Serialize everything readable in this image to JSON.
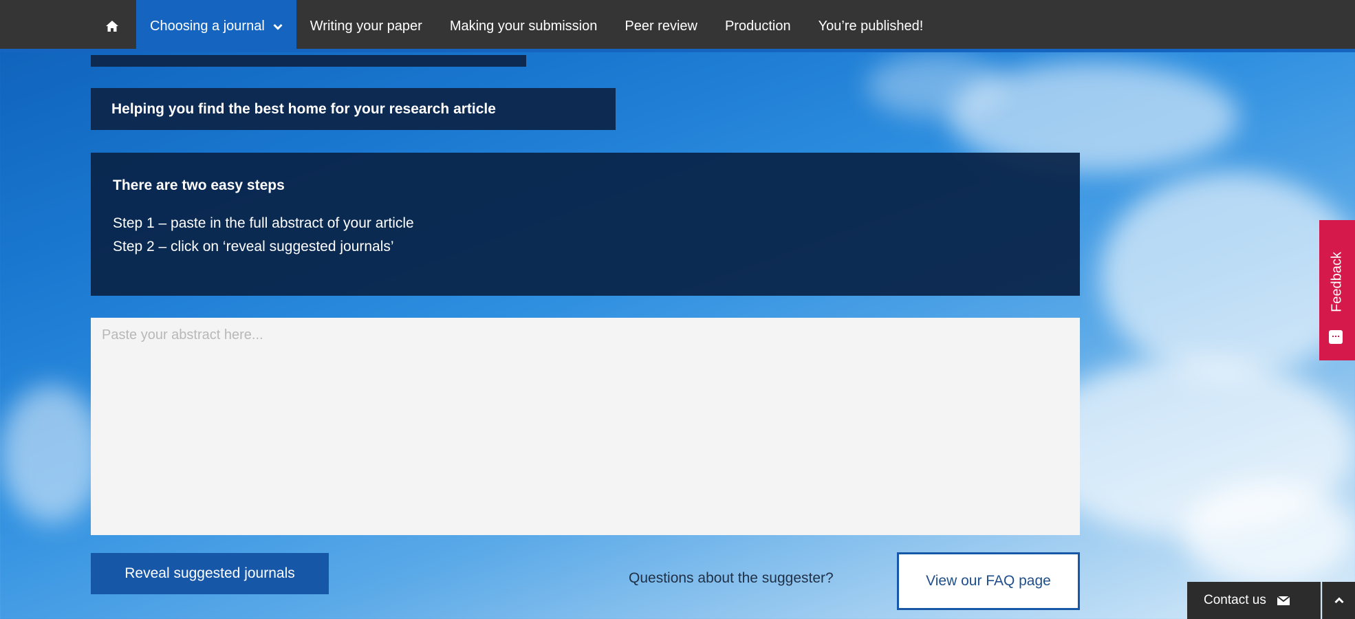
{
  "nav": {
    "home_icon": "home-icon",
    "items": [
      {
        "label": "Choosing a journal",
        "active": true
      },
      {
        "label": "Writing your paper"
      },
      {
        "label": "Making your submission"
      },
      {
        "label": "Peer review"
      },
      {
        "label": "Production"
      },
      {
        "label": "You’re published!"
      }
    ],
    "chevron_icon": "chevron-down-icon"
  },
  "hero": {
    "heading": "Helping you find the best home for your research article",
    "steps_title": "There are two easy steps",
    "step1": "Step 1 – paste in the full abstract of your article",
    "step2": "Step 2 – click on ‘reveal suggested journals’"
  },
  "abstract": {
    "placeholder": "Paste your abstract here...",
    "value": ""
  },
  "actions": {
    "reveal_label": "Reveal suggested journals",
    "questions_text": "Questions about the suggester?",
    "faq_label": "View our FAQ page"
  },
  "feedback": {
    "label": "Feedback",
    "icon": "chat-icon"
  },
  "footer": {
    "contact_label": "Contact us",
    "contact_icon": "envelope-icon",
    "top_icon": "chevron-up-icon"
  },
  "colors": {
    "nav_bg": "#353535",
    "accent_blue": "#1565c0",
    "dark_panel": "#0d2a52",
    "feedback_red": "#d5194a"
  }
}
